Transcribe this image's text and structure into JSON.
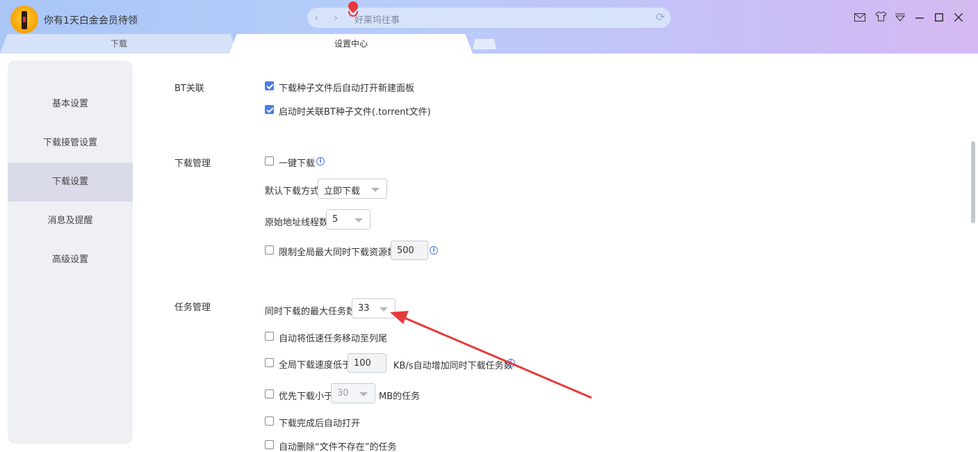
{
  "titlebar": {
    "promo_text": "你有1天白金会员待领",
    "address_text": "好莱坞往事"
  },
  "tabs": [
    {
      "label": "下载"
    },
    {
      "label": "设置中心"
    }
  ],
  "sidebar": {
    "items": [
      {
        "label": "基本设置"
      },
      {
        "label": "下载接管设置"
      },
      {
        "label": "下载设置"
      },
      {
        "label": "消息及提醒"
      },
      {
        "label": "高级设置"
      }
    ]
  },
  "bt": {
    "section_title": "BT关联",
    "auto_open_panel": {
      "label": "下载种子文件后自动打开新建面板",
      "checked": true
    },
    "associate_torrent": {
      "label": "启动时关联BT种子文件(.torrent文件)",
      "checked": true
    }
  },
  "download_mgmt": {
    "section_title": "下载管理",
    "one_click": {
      "label": "一键下载",
      "checked": false
    },
    "default_mode_label": "默认下载方式",
    "default_mode_value": "立即下载",
    "threads_label": "原始地址线程数",
    "threads_value": "5",
    "limit_sources": {
      "label": "限制全局最大同时下载资源数",
      "checked": false,
      "value": "500"
    }
  },
  "task_mgmt": {
    "section_title": "任务管理",
    "max_tasks_label": "同时下载的最大任务数",
    "max_tasks_value": "33",
    "move_slow": {
      "label": "自动将低速任务移动至列尾",
      "checked": false
    },
    "speed_below": {
      "label": "全局下载速度低于",
      "value": "100",
      "suffix": "KB/s自动增加同时下载任务数",
      "checked": false
    },
    "priority_small": {
      "label": "优先下载小于",
      "value": "30",
      "suffix": "MB的任务",
      "checked": false
    },
    "auto_open": {
      "label": "下载完成后自动打开",
      "checked": false
    },
    "auto_delete_missing": {
      "label": "自动删除“文件不存在”的任务",
      "checked": false
    }
  },
  "colors": {
    "accent": "#4d7de6",
    "annotation_arrow": "#e53b3b"
  }
}
